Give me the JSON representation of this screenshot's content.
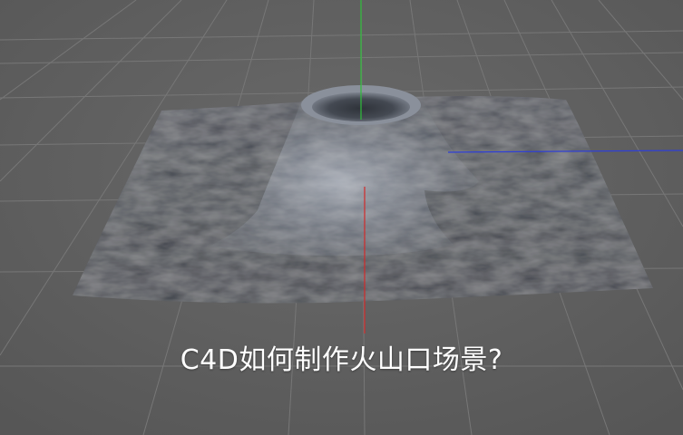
{
  "viewport": {
    "background_color": "#5e5e5e",
    "grid_color": "#767676",
    "axis_colors": {
      "x": "#d12a2a",
      "y": "#2fbf3a",
      "z": "#2f3fd6"
    },
    "object": "volcano-terrain-mesh"
  },
  "caption": {
    "text": "C4D如何制作火山口场景?"
  }
}
